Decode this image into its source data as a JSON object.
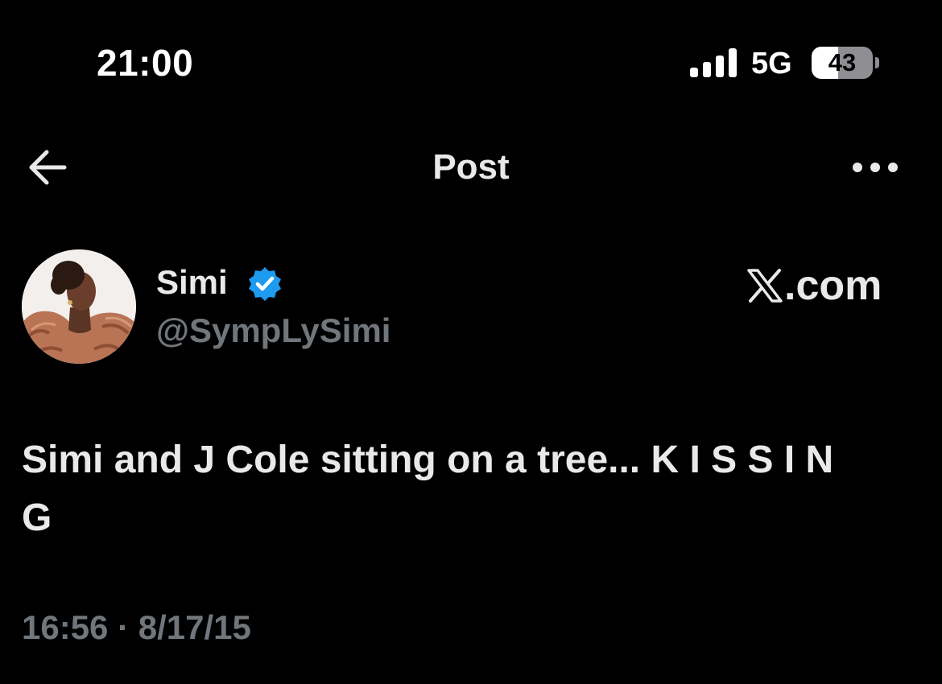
{
  "status_bar": {
    "time": "21:00",
    "network": "5G",
    "battery_percent": "43",
    "battery_level": 0.43,
    "signal_bars": 4
  },
  "header": {
    "title": "Post",
    "back_icon": "arrow-left-icon",
    "more_icon": "more-horizontal-icon"
  },
  "post": {
    "author": {
      "name": "Simi",
      "handle": "@SympLySimi",
      "verified": true,
      "verified_icon": "verified-badge-icon",
      "verified_color": "#1d9bf0"
    },
    "watermark": {
      "logo": "x-logo-icon",
      "domain": ".com"
    },
    "text": "Simi and J Cole sitting on a tree... K I S S I N\nG",
    "time": "16:56",
    "separator": "·",
    "date": "8/17/15"
  },
  "colors": {
    "background": "#000000",
    "primary_text": "#e7e9ea",
    "secondary_text": "#71767b",
    "accent": "#1d9bf0"
  }
}
